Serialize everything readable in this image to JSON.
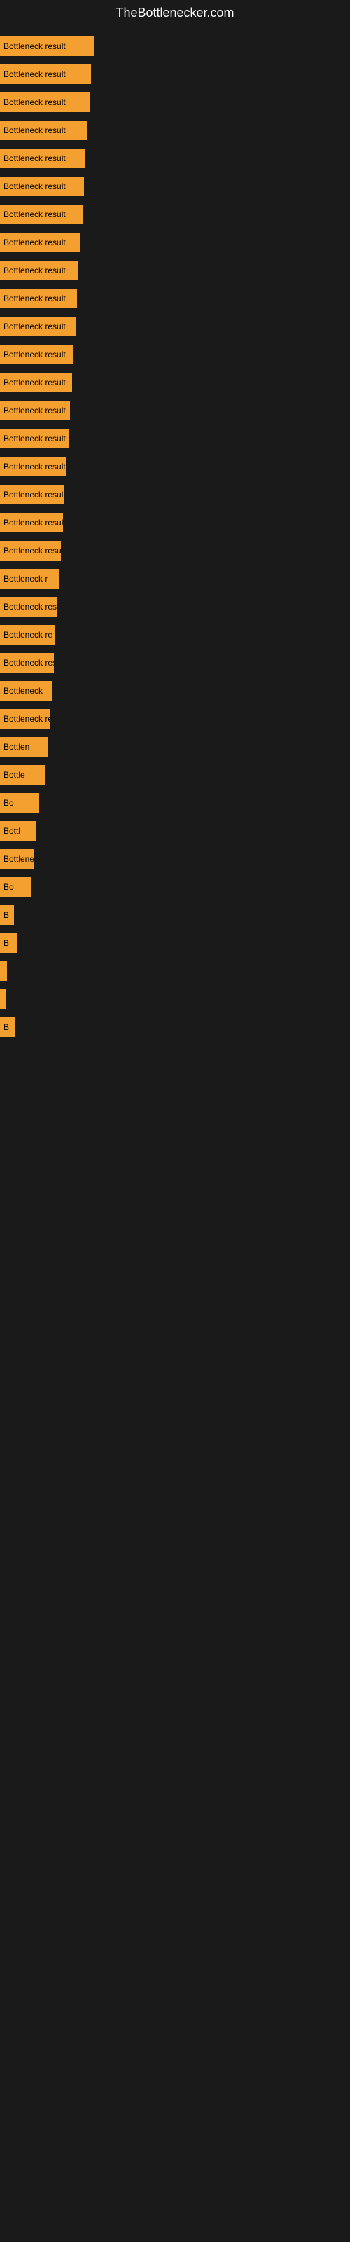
{
  "site": {
    "title": "TheBottlenecker.com"
  },
  "bars": [
    {
      "label": "Bottleneck result",
      "width": 135
    },
    {
      "label": "Bottleneck result",
      "width": 130
    },
    {
      "label": "Bottleneck result",
      "width": 128
    },
    {
      "label": "Bottleneck result",
      "width": 125
    },
    {
      "label": "Bottleneck result",
      "width": 122
    },
    {
      "label": "Bottleneck result",
      "width": 120
    },
    {
      "label": "Bottleneck result",
      "width": 118
    },
    {
      "label": "Bottleneck result",
      "width": 115
    },
    {
      "label": "Bottleneck result",
      "width": 112
    },
    {
      "label": "Bottleneck result",
      "width": 110
    },
    {
      "label": "Bottleneck result",
      "width": 108
    },
    {
      "label": "Bottleneck result",
      "width": 105
    },
    {
      "label": "Bottleneck result",
      "width": 103
    },
    {
      "label": "Bottleneck result",
      "width": 100
    },
    {
      "label": "Bottleneck result",
      "width": 98
    },
    {
      "label": "Bottleneck result",
      "width": 95
    },
    {
      "label": "Bottleneck resul",
      "width": 92
    },
    {
      "label": "Bottleneck result",
      "width": 90
    },
    {
      "label": "Bottleneck resu",
      "width": 87
    },
    {
      "label": "Bottleneck r",
      "width": 84
    },
    {
      "label": "Bottleneck resu",
      "width": 82
    },
    {
      "label": "Bottleneck re",
      "width": 79
    },
    {
      "label": "Bottleneck result",
      "width": 77
    },
    {
      "label": "Bottleneck",
      "width": 74
    },
    {
      "label": "Bottleneck res",
      "width": 72
    },
    {
      "label": "Bottlen",
      "width": 69
    },
    {
      "label": "Bottle",
      "width": 65
    },
    {
      "label": "Bo",
      "width": 56
    },
    {
      "label": "Bottl",
      "width": 52
    },
    {
      "label": "Bottlene",
      "width": 48
    },
    {
      "label": "Bo",
      "width": 44
    },
    {
      "label": "B",
      "width": 20
    },
    {
      "label": "B",
      "width": 25
    },
    {
      "label": "",
      "width": 10
    },
    {
      "label": "",
      "width": 8
    },
    {
      "label": "B",
      "width": 22
    }
  ],
  "colors": {
    "bar_fill": "#f4a030",
    "background": "#1a1a1a",
    "title": "#ffffff",
    "label": "#000000"
  }
}
